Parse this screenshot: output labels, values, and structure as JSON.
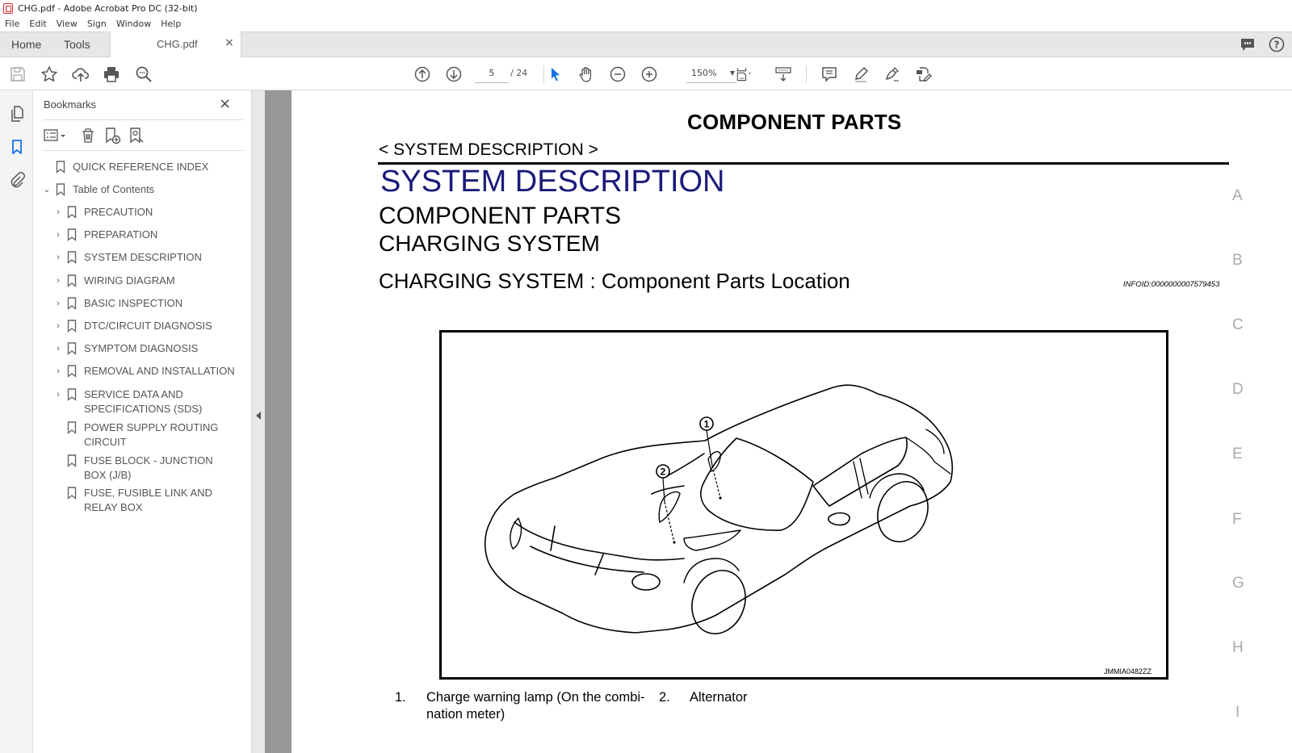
{
  "window": {
    "title": "CHG.pdf - Adobe Acrobat Pro DC (32-bit)"
  },
  "menu": [
    "File",
    "Edit",
    "View",
    "Sign",
    "Window",
    "Help"
  ],
  "tabs": {
    "home": "Home",
    "tools": "Tools",
    "document": "CHG.pdf",
    "close_symbol": "×"
  },
  "header_icons": [
    "comment-bubble-icon",
    "help-icon"
  ],
  "toolbar": {
    "left_icons": [
      "save-icon",
      "bookmark-star-icon",
      "upload-cloud-icon",
      "print-icon",
      "search-zoom-icon"
    ],
    "page_current": "5",
    "page_total": "/ 24",
    "zoom_level": "150%",
    "center_icons": [
      "prev-page-icon",
      "next-page-icon",
      "select-cursor-icon",
      "hand-icon",
      "zoom-out-icon",
      "zoom-in-icon",
      "fit-page-icon",
      "scroll-mode-icon"
    ],
    "right_icons": [
      "comment-icon",
      "highlight-pen-icon",
      "sign-icon",
      "edit-export-icon"
    ]
  },
  "navrail": [
    "pages-icon",
    "bookmarks-icon",
    "attachments-icon"
  ],
  "bookmarks": {
    "title": "Bookmarks",
    "close": "×",
    "tools": [
      "options-menu-icon",
      "delete-icon",
      "new-bookmark-icon",
      "bookmark-search-icon"
    ],
    "items": [
      {
        "label": "QUICK REFERENCE INDEX",
        "level": 0,
        "expander": ""
      },
      {
        "label": "Table of Contents",
        "level": 0,
        "expander": "⌄"
      },
      {
        "label": "PRECAUTION",
        "level": 1,
        "expander": "›"
      },
      {
        "label": "PREPARATION",
        "level": 1,
        "expander": "›"
      },
      {
        "label": "SYSTEM DESCRIPTION",
        "level": 1,
        "expander": "›"
      },
      {
        "label": "WIRING DIAGRAM",
        "level": 1,
        "expander": "›"
      },
      {
        "label": "BASIC INSPECTION",
        "level": 1,
        "expander": "›"
      },
      {
        "label": "DTC/CIRCUIT DIAGNOSIS",
        "level": 1,
        "expander": "›"
      },
      {
        "label": "SYMPTOM DIAGNOSIS",
        "level": 1,
        "expander": "›"
      },
      {
        "label": "REMOVAL AND INSTALLATION",
        "level": 1,
        "expander": "›"
      },
      {
        "label": "SERVICE DATA AND SPECIFICATIONS (SDS)",
        "level": 1,
        "expander": "›"
      },
      {
        "label": "POWER SUPPLY ROUTING CIRCUIT",
        "level": 1,
        "expander": ""
      },
      {
        "label": "FUSE BLOCK - JUNCTION BOX (J/B)",
        "level": 1,
        "expander": ""
      },
      {
        "label": "FUSE, FUSIBLE LINK AND RELAY BOX",
        "level": 1,
        "expander": ""
      }
    ]
  },
  "document": {
    "page_title": "COMPONENT PARTS",
    "breadcrumb": "< SYSTEM DESCRIPTION >",
    "section": "SYSTEM DESCRIPTION",
    "subsection": "COMPONENT PARTS",
    "system": "CHARGING SYSTEM",
    "heading": "CHARGING SYSTEM : Component Parts Location",
    "info_id": "INFOID:0000000007579453",
    "figure_code": "JMMIA0482ZZ",
    "callouts": [
      "①",
      "②"
    ],
    "captions": [
      {
        "num": "1.",
        "text": "Charge warning lamp (On the combi-nation meter)"
      },
      {
        "num": "2.",
        "text": "Alternator"
      }
    ],
    "side_letters": [
      "A",
      "B",
      "C",
      "D",
      "E",
      "F",
      "G",
      "H",
      "I"
    ]
  },
  "colors": {
    "section_heading": "#1a1a7a",
    "active_accent": "#1473e6",
    "adobe_red": "#d7282f"
  }
}
